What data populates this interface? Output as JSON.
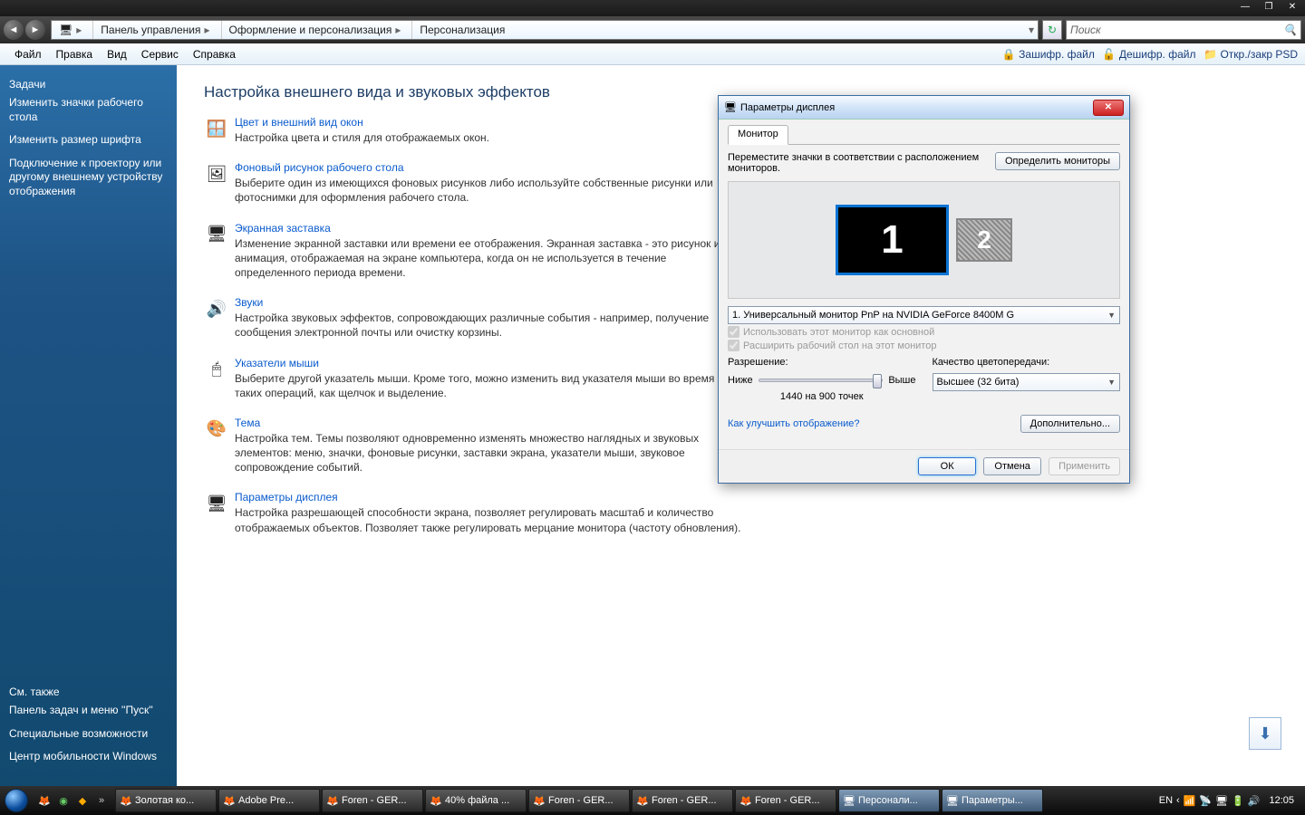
{
  "titlebar": {
    "minimize": "—",
    "maximize": "❐",
    "close": "✕"
  },
  "breadcrumb": {
    "segments": [
      "Панель управления",
      "Оформление и персонализация",
      "Персонализация"
    ],
    "search_placeholder": "Поиск"
  },
  "menubar": {
    "file": "Файл",
    "edit": "Правка",
    "view": "Вид",
    "tools": "Сервис",
    "help": "Справка",
    "encrypt": "Зашифр. файл",
    "decrypt": "Дешифр. файл",
    "psd": "Откр./закр PSD"
  },
  "sidebar": {
    "tasks_hd": "Задачи",
    "links": [
      "Изменить значки рабочего стола",
      "Изменить размер шрифта",
      "Подключение к проектору или другому внешнему устройству отображения"
    ],
    "see_also_hd": "См. также",
    "see_also": [
      "Панель задач и меню ''Пуск''",
      "Специальные возможности",
      "Центр мобильности Windows"
    ]
  },
  "content": {
    "heading": "Настройка внешнего вида и звуковых эффектов",
    "sections": [
      {
        "title": "Цвет и внешний вид окон",
        "desc": "Настройка цвета и стиля для отображаемых окон."
      },
      {
        "title": "Фоновый рисунок рабочего стола",
        "desc": "Выберите один из имеющихся фоновых рисунков либо используйте собственные рисунки или фотоснимки для оформления рабочего стола."
      },
      {
        "title": "Экранная заставка",
        "desc": "Изменение экранной заставки или времени ее отображения. Экранная заставка - это рисунок или анимация, отображаемая на экране компьютера, когда он не используется в течение определенного периода времени."
      },
      {
        "title": "Звуки",
        "desc": "Настройка звуковых эффектов, сопровождающих различные события - например, получение сообщения электронной почты или очистку корзины."
      },
      {
        "title": "Указатели мыши",
        "desc": "Выберите другой указатель мыши. Кроме того, можно изменить вид указателя мыши во время таких операций, как щелчок и выделение."
      },
      {
        "title": "Тема",
        "desc": "Настройка тем. Темы позволяют одновременно изменять множество наглядных и звуковых элементов: меню, значки, фоновые рисунки, заставки экрана, указатели мыши, звуковое сопровождение событий."
      },
      {
        "title": "Параметры дисплея",
        "desc": "Настройка разрешающей способности экрана, позволяет регулировать масштаб и количество отображаемых объектов. Позволяет также регулировать мерцание монитора (частоту обновления)."
      }
    ]
  },
  "dialog": {
    "title": "Параметры дисплея",
    "tab": "Монитор",
    "instruction": "Переместите значки в соответствии с расположением мониторов.",
    "identify_btn": "Определить мониторы",
    "monitor1": "1",
    "monitor2": "2",
    "monitor_select": "1. Универсальный монитор PnP на NVIDIA GeForce 8400M G",
    "chk_primary": "Использовать этот монитор как основной",
    "chk_extend": "Расширить рабочий стол на этот монитор",
    "resolution_label": "Разрешение:",
    "quality_label": "Качество цветопередачи:",
    "low": "Ниже",
    "high": "Выше",
    "quality_value": "Высшее (32 бита)",
    "resolution_value": "1440 на 900 точек",
    "help_link": "Как улучшить отображение?",
    "advanced_btn": "Дополнительно...",
    "ok": "ОК",
    "cancel": "Отмена",
    "apply": "Применить"
  },
  "taskbar": {
    "items": [
      "Золотая ко...",
      "Adobe Pre...",
      "Foren - GER...",
      "40% файла ...",
      "Foren - GER...",
      "Foren - GER...",
      "Foren - GER...",
      "Персонали...",
      "Параметры..."
    ],
    "lang": "EN",
    "clock": "12:05"
  }
}
